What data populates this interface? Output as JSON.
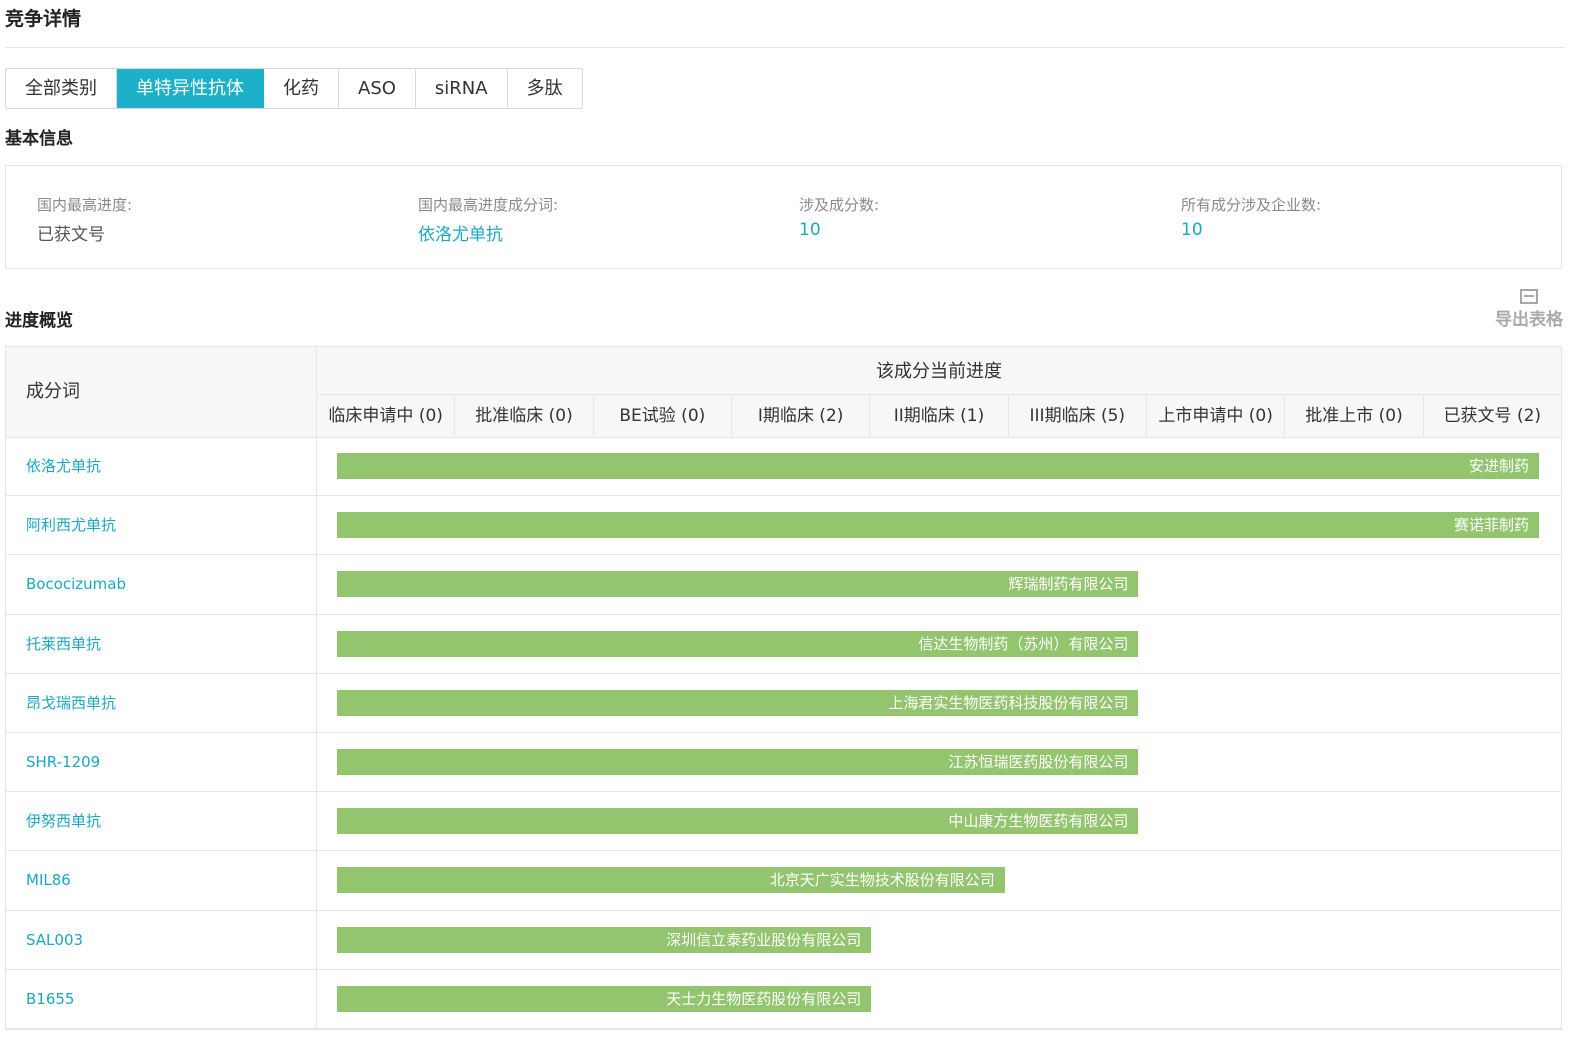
{
  "page_title": "竞争详情",
  "tabs": [
    {
      "label": "全部类别",
      "active": false
    },
    {
      "label": "单特异性抗体",
      "active": true
    },
    {
      "label": "化药",
      "active": false
    },
    {
      "label": "ASO",
      "active": false
    },
    {
      "label": "siRNA",
      "active": false
    },
    {
      "label": "多肽",
      "active": false
    }
  ],
  "basic_info": {
    "title": "基本信息",
    "items": [
      {
        "label": "国内最高进度:",
        "value": "已获文号",
        "link": false
      },
      {
        "label": "国内最高进度成分词:",
        "value": "依洛尤单抗",
        "link": true
      },
      {
        "label": "涉及成分数:",
        "value": "10",
        "link": true
      },
      {
        "label": "所有成分涉及企业数:",
        "value": "10",
        "link": true
      }
    ]
  },
  "progress": {
    "title": "进度概览",
    "export_label": "导出表格",
    "name_header": "成分词",
    "group_header": "该成分当前进度",
    "stages": [
      "临床申请中 (0)",
      "批准临床 (0)",
      "BE试验 (0)",
      "I期临床 (2)",
      "II期临床 (1)",
      "III期临床 (5)",
      "上市申请中 (0)",
      "批准上市 (0)",
      "已获文号 (2)"
    ],
    "rows": [
      {
        "name": "依洛尤单抗",
        "company": "安进制药",
        "stage_index": 8
      },
      {
        "name": "阿利西尤单抗",
        "company": "赛诺菲制药",
        "stage_index": 8
      },
      {
        "name": "Bococizumab",
        "company": "辉瑞制药有限公司",
        "stage_index": 5
      },
      {
        "name": "托莱西单抗",
        "company": "信达生物制药（苏州）有限公司",
        "stage_index": 5
      },
      {
        "name": "昂戈瑞西单抗",
        "company": "上海君实生物医药科技股份有限公司",
        "stage_index": 5
      },
      {
        "name": "SHR-1209",
        "company": "江苏恒瑞医药股份有限公司",
        "stage_index": 5
      },
      {
        "name": "伊努西单抗",
        "company": "中山康方生物医药有限公司",
        "stage_index": 5
      },
      {
        "name": "MIL86",
        "company": "北京天广实生物技术股份有限公司",
        "stage_index": 4
      },
      {
        "name": "SAL003",
        "company": "深圳信立泰药业股份有限公司",
        "stage_index": 3
      },
      {
        "name": "B1655",
        "company": "天士力生物医药股份有限公司",
        "stage_index": 3
      }
    ]
  },
  "colors": {
    "accent": "#1cb0c9",
    "link": "#1ba8c2",
    "bar": "#93c46e"
  }
}
